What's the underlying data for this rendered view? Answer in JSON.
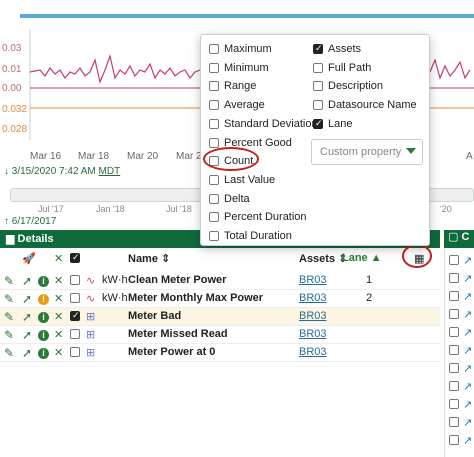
{
  "chart": {
    "y_ticks_top": [
      "0.03",
      "0.01",
      "0.00"
    ],
    "y_ticks_bottom": [
      "0.032",
      "0.028"
    ],
    "x_ticks": [
      "Mar 16",
      "Mar 18",
      "Mar 20",
      "Mar 22",
      "A"
    ],
    "colors": {
      "line": "#c43a7a",
      "series2": "#e08a40",
      "axis": "#ddd"
    }
  },
  "date_start": {
    "date": "3/15/2020 7:42 AM",
    "tz": "MDT"
  },
  "range": {
    "labels": [
      "Jul '17",
      "Jan '18",
      "Jul '18",
      "'20"
    ]
  },
  "date_end": "6/17/2017",
  "details": {
    "title": "Details",
    "right_title": "C"
  },
  "table": {
    "columns": {
      "name": "Name",
      "assets": "Assets",
      "lane": "Lane"
    },
    "rows": [
      {
        "unit": "kW·h",
        "name": "Clean Meter Power",
        "asset": "BR03",
        "lane": "1",
        "checked": false,
        "warn": false
      },
      {
        "unit": "kW·h",
        "name": "Meter Monthly Max Power",
        "asset": "BR03",
        "lane": "2",
        "checked": false,
        "warn": true
      },
      {
        "unit": "",
        "name": "Meter Bad",
        "asset": "BR03",
        "lane": "",
        "checked": true,
        "warn": false
      },
      {
        "unit": "",
        "name": "Meter Missed Read",
        "asset": "BR03",
        "lane": "",
        "checked": false,
        "warn": false
      },
      {
        "unit": "",
        "name": "Meter Power at 0",
        "asset": "BR03",
        "lane": "",
        "checked": false,
        "warn": false
      }
    ]
  },
  "menu": {
    "left": [
      {
        "label": "Maximum",
        "checked": false
      },
      {
        "label": "Minimum",
        "checked": false
      },
      {
        "label": "Range",
        "checked": false
      },
      {
        "label": "Average",
        "checked": false
      },
      {
        "label": "Standard Deviation",
        "checked": false
      },
      {
        "label": "Percent Good",
        "checked": false
      },
      {
        "label": "Count",
        "checked": false
      },
      {
        "label": "Last Value",
        "checked": false
      },
      {
        "label": "Delta",
        "checked": false
      },
      {
        "label": "Percent Duration",
        "checked": false
      },
      {
        "label": "Total Duration",
        "checked": false
      }
    ],
    "right": [
      {
        "label": "Assets",
        "checked": true
      },
      {
        "label": "Full Path",
        "checked": false
      },
      {
        "label": "Description",
        "checked": false
      },
      {
        "label": "Datasource Name",
        "checked": false
      },
      {
        "label": "Lane",
        "checked": true
      }
    ],
    "custom_property_placeholder": "Custom property"
  }
}
